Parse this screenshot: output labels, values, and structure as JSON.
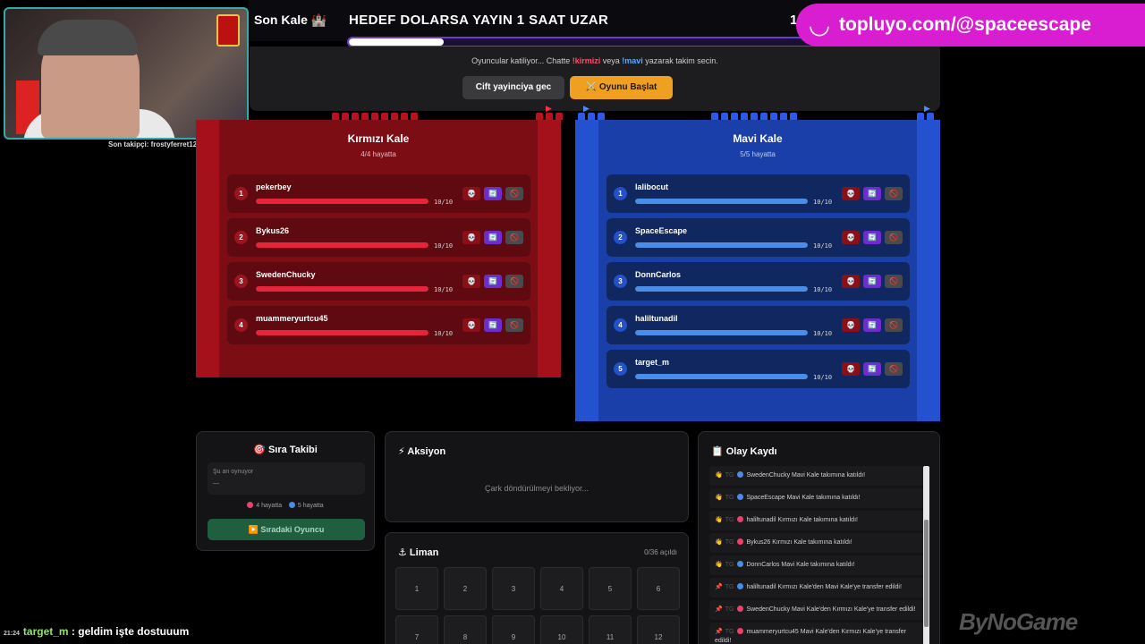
{
  "header": {
    "brand": "Son Kale 🏰",
    "goal": "HEDEF DOLARSA YAYIN 1 SAAT UZAR",
    "goal_number": "1",
    "goal_progress": 0.19
  },
  "promo": {
    "icon": "smile-icon",
    "text": "topluyo.com/@spaceescape",
    "color": "#d81ed0"
  },
  "webcam": {
    "follower_text": "Son takipçi: frostyferret12"
  },
  "control": {
    "msg_prefix": "Oyuncular katiliyor... Chatte ",
    "msg_red": "!kirmizi",
    "msg_mid": " veya ",
    "msg_blue": "!mavi",
    "msg_suffix": " yazarak takim secin.",
    "double_btn": "Cift yayinciya gec",
    "start_btn": "⚔️ Oyunu Başlat"
  },
  "red_castle": {
    "title": "Kırmızı Kale",
    "subtitle": "4/4 hayatta",
    "color": "#7d0d14",
    "players": [
      {
        "num": "1",
        "name": "pekerbey",
        "hp": "10/10",
        "hp_fraction": 1.0
      },
      {
        "num": "2",
        "name": "Bykus26",
        "hp": "10/10",
        "hp_fraction": 1.0
      },
      {
        "num": "3",
        "name": "SwedenChucky",
        "hp": "10/10",
        "hp_fraction": 1.0
      },
      {
        "num": "4",
        "name": "muammeryurtcu45",
        "hp": "10/10",
        "hp_fraction": 1.0
      }
    ]
  },
  "blue_castle": {
    "title": "Mavi Kale",
    "subtitle": "5/5 hayatta",
    "color": "#1a3fa8",
    "players": [
      {
        "num": "1",
        "name": "lalibocut",
        "hp": "10/10",
        "hp_fraction": 1.0
      },
      {
        "num": "2",
        "name": "SpaceEscape",
        "hp": "10/10",
        "hp_fraction": 1.0
      },
      {
        "num": "3",
        "name": "DonnCarlos",
        "hp": "10/10",
        "hp_fraction": 1.0
      },
      {
        "num": "4",
        "name": "haliltunadil",
        "hp": "10/10",
        "hp_fraction": 1.0
      },
      {
        "num": "5",
        "name": "target_m",
        "hp": "10/10",
        "hp_fraction": 1.0
      }
    ]
  },
  "player_actions": {
    "kill_icon": "💀",
    "swap_icon": "🔄",
    "ban_icon": "🚫"
  },
  "turn": {
    "title": "🎯 Sıra Takibi",
    "now_label": "Şu an oynuyor",
    "now_value": "—",
    "red_alive": "4 hayatta",
    "blue_alive": "5 hayatta",
    "next_btn": "▶️ Sıradaki Oyuncu"
  },
  "action": {
    "title": "⚡ Aksiyon",
    "waiting": "Çark döndürülmeyi bekliyor..."
  },
  "port": {
    "title": "⚓ Liman",
    "opened": "0/36 açıldı",
    "cells": [
      "1",
      "2",
      "3",
      "4",
      "5",
      "6",
      "7",
      "8",
      "9",
      "10",
      "11",
      "12"
    ]
  },
  "log": {
    "title": "📋 Olay Kaydı",
    "entries": [
      {
        "icon": "👋",
        "time": "TG",
        "team": "blue",
        "text": "SwedenChucky Mavi Kale takımına katıldı!"
      },
      {
        "icon": "👋",
        "time": "TG",
        "team": "blue",
        "text": "SpaceEscape Mavi Kale takımına katıldı!"
      },
      {
        "icon": "👋",
        "time": "TG",
        "team": "red",
        "text": "haliltunadil Kırmızı Kale takımına katıldı!"
      },
      {
        "icon": "👋",
        "time": "TG",
        "team": "red",
        "text": "Bykus26 Kırmızı Kale takımına katıldı!"
      },
      {
        "icon": "👋",
        "time": "TG",
        "team": "blue",
        "text": "DonnCarlos Mavi Kale takımına katıldı!"
      },
      {
        "icon": "📌",
        "time": "TG",
        "team": "blue",
        "text": "haliltunadil Kırmızı Kale'den Mavi Kale'ye transfer edildi!"
      },
      {
        "icon": "📌",
        "time": "TG",
        "team": "red",
        "text": "SwedenChucky Mavi Kale'den Kırmızı Kale'ye transfer edildi!"
      },
      {
        "icon": "📌",
        "time": "TG",
        "team": "red",
        "text": "muammeryurtcu45 Mavi Kale'den Kırmızı Kale'ye transfer edildi!"
      }
    ]
  },
  "chat": {
    "time": "21:24",
    "user": "target_m",
    "message": " : geldim işte dostuuum"
  },
  "watermark": {
    "text": "ByNoGame"
  },
  "colors": {
    "red": "#e8243a",
    "blue": "#4a8de8",
    "accent": "#f0a020"
  }
}
